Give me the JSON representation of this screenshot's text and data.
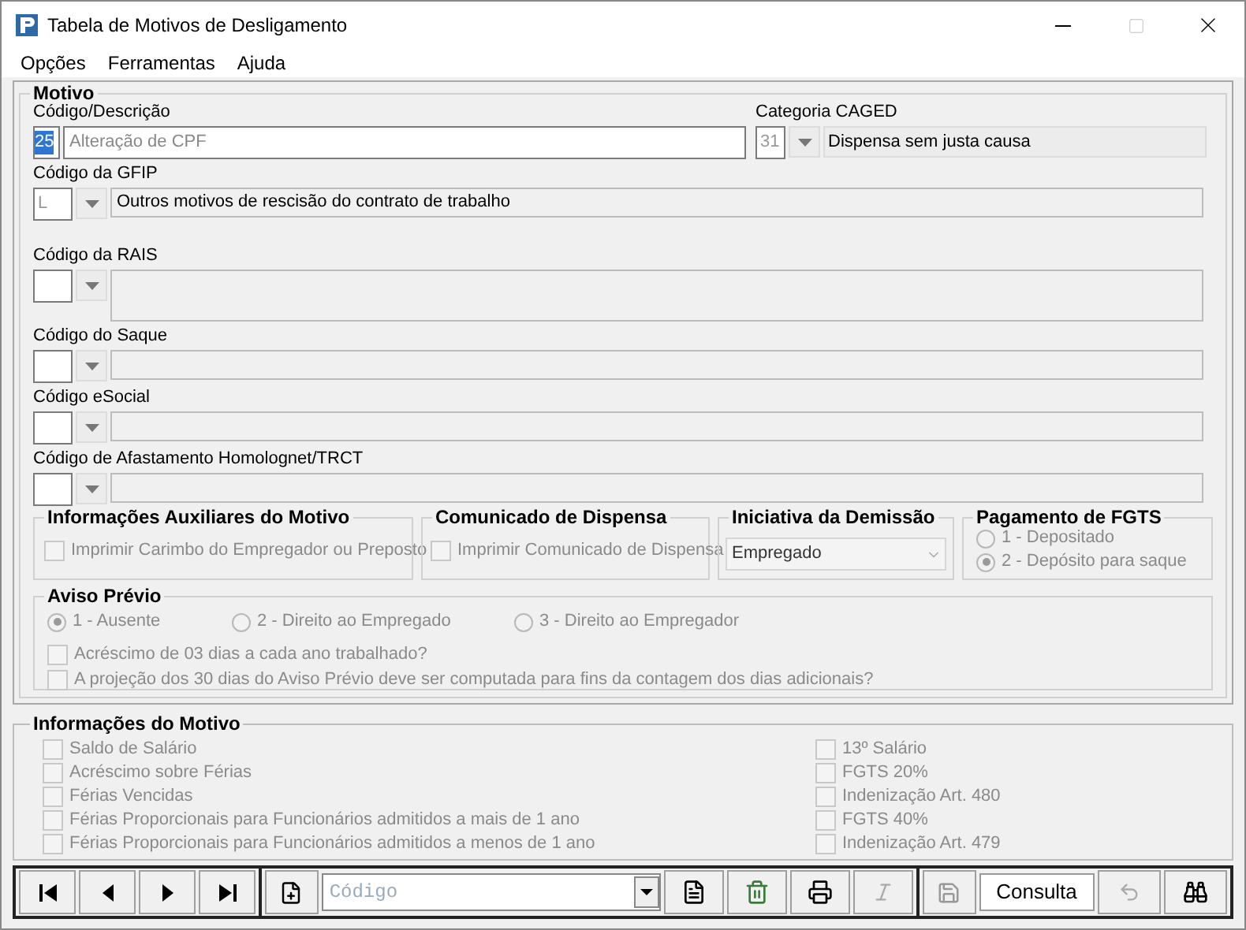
{
  "window": {
    "title": "Tabela de Motivos de Desligamento"
  },
  "menu": [
    "Opções",
    "Ferramentas",
    "Ajuda"
  ],
  "motivo": {
    "title": "Motivo",
    "code_label": "Código/Descrição",
    "code": "25",
    "description": "Alteração de CPF",
    "caged": {
      "label": "Categoria CAGED",
      "code": "31",
      "description": "Dispensa sem justa causa"
    }
  },
  "lookups": [
    {
      "kind": "single",
      "label": "Código da GFIP",
      "code": "L",
      "description": "Outros motivos de rescisão do contrato de trabalho"
    },
    {
      "kind": "tall",
      "label": "Código da RAIS"
    },
    {
      "kind": "single",
      "label": "Código do Saque"
    },
    {
      "kind": "single",
      "label": "Código eSocial"
    },
    {
      "kind": "single",
      "label": "Código de Afastamento Homolognet/TRCT"
    }
  ],
  "aux": {
    "title": "Informações Auxiliares do Motivo",
    "checkbox": {
      "label": "Imprimir Carimbo do Empregador ou Preposto",
      "checked": false
    }
  },
  "comunicado": {
    "title": "Comunicado de Dispensa",
    "checkbox": {
      "label": "Imprimir Comunicado de Dispensa",
      "checked": false
    }
  },
  "iniciativa": {
    "title": "Iniciativa da Demissão",
    "value": "Empregado"
  },
  "pagamento": {
    "title": "Pagamento de FGTS",
    "options": [
      {
        "label": "1 - Depositado",
        "selected": false
      },
      {
        "label": "2 - Depósito para saque",
        "selected": true
      }
    ]
  },
  "aviso": {
    "title": "Aviso Prévio",
    "options": [
      {
        "label": "1 - Ausente",
        "selected": true
      },
      {
        "label": "2 - Direito ao Empregado",
        "selected": false
      },
      {
        "label": "3 - Direito ao Empregador",
        "selected": false
      }
    ],
    "checks": [
      {
        "label": "Acréscimo de 03 dias a cada ano trabalhado?",
        "checked": false
      },
      {
        "label": "A projeção dos 30 dias do Aviso Prévio deve ser computada para fins da contagem dos dias adicionais?",
        "checked": false
      }
    ]
  },
  "info": {
    "title": "Informações do Motivo",
    "left": [
      {
        "label": "Saldo de Salário",
        "checked": false
      },
      {
        "label": "Acréscimo sobre Férias",
        "checked": false
      },
      {
        "label": "Férias Vencidas",
        "checked": false
      },
      {
        "label": "Férias Proporcionais para Funcionários admitidos a mais de 1 ano",
        "checked": false
      },
      {
        "label": "Férias Proporcionais para Funcionários admitidos a menos de 1 ano",
        "checked": false
      }
    ],
    "right": [
      {
        "label": "13º Salário",
        "checked": false
      },
      {
        "label": "FGTS 20%",
        "checked": false
      },
      {
        "label": "Indenização Art. 480",
        "checked": false
      },
      {
        "label": "FGTS 40%",
        "checked": false
      },
      {
        "label": "Indenização Art. 479",
        "checked": false
      }
    ]
  },
  "toolbar": {
    "search_placeholder": "Código",
    "mode": "Consulta"
  }
}
